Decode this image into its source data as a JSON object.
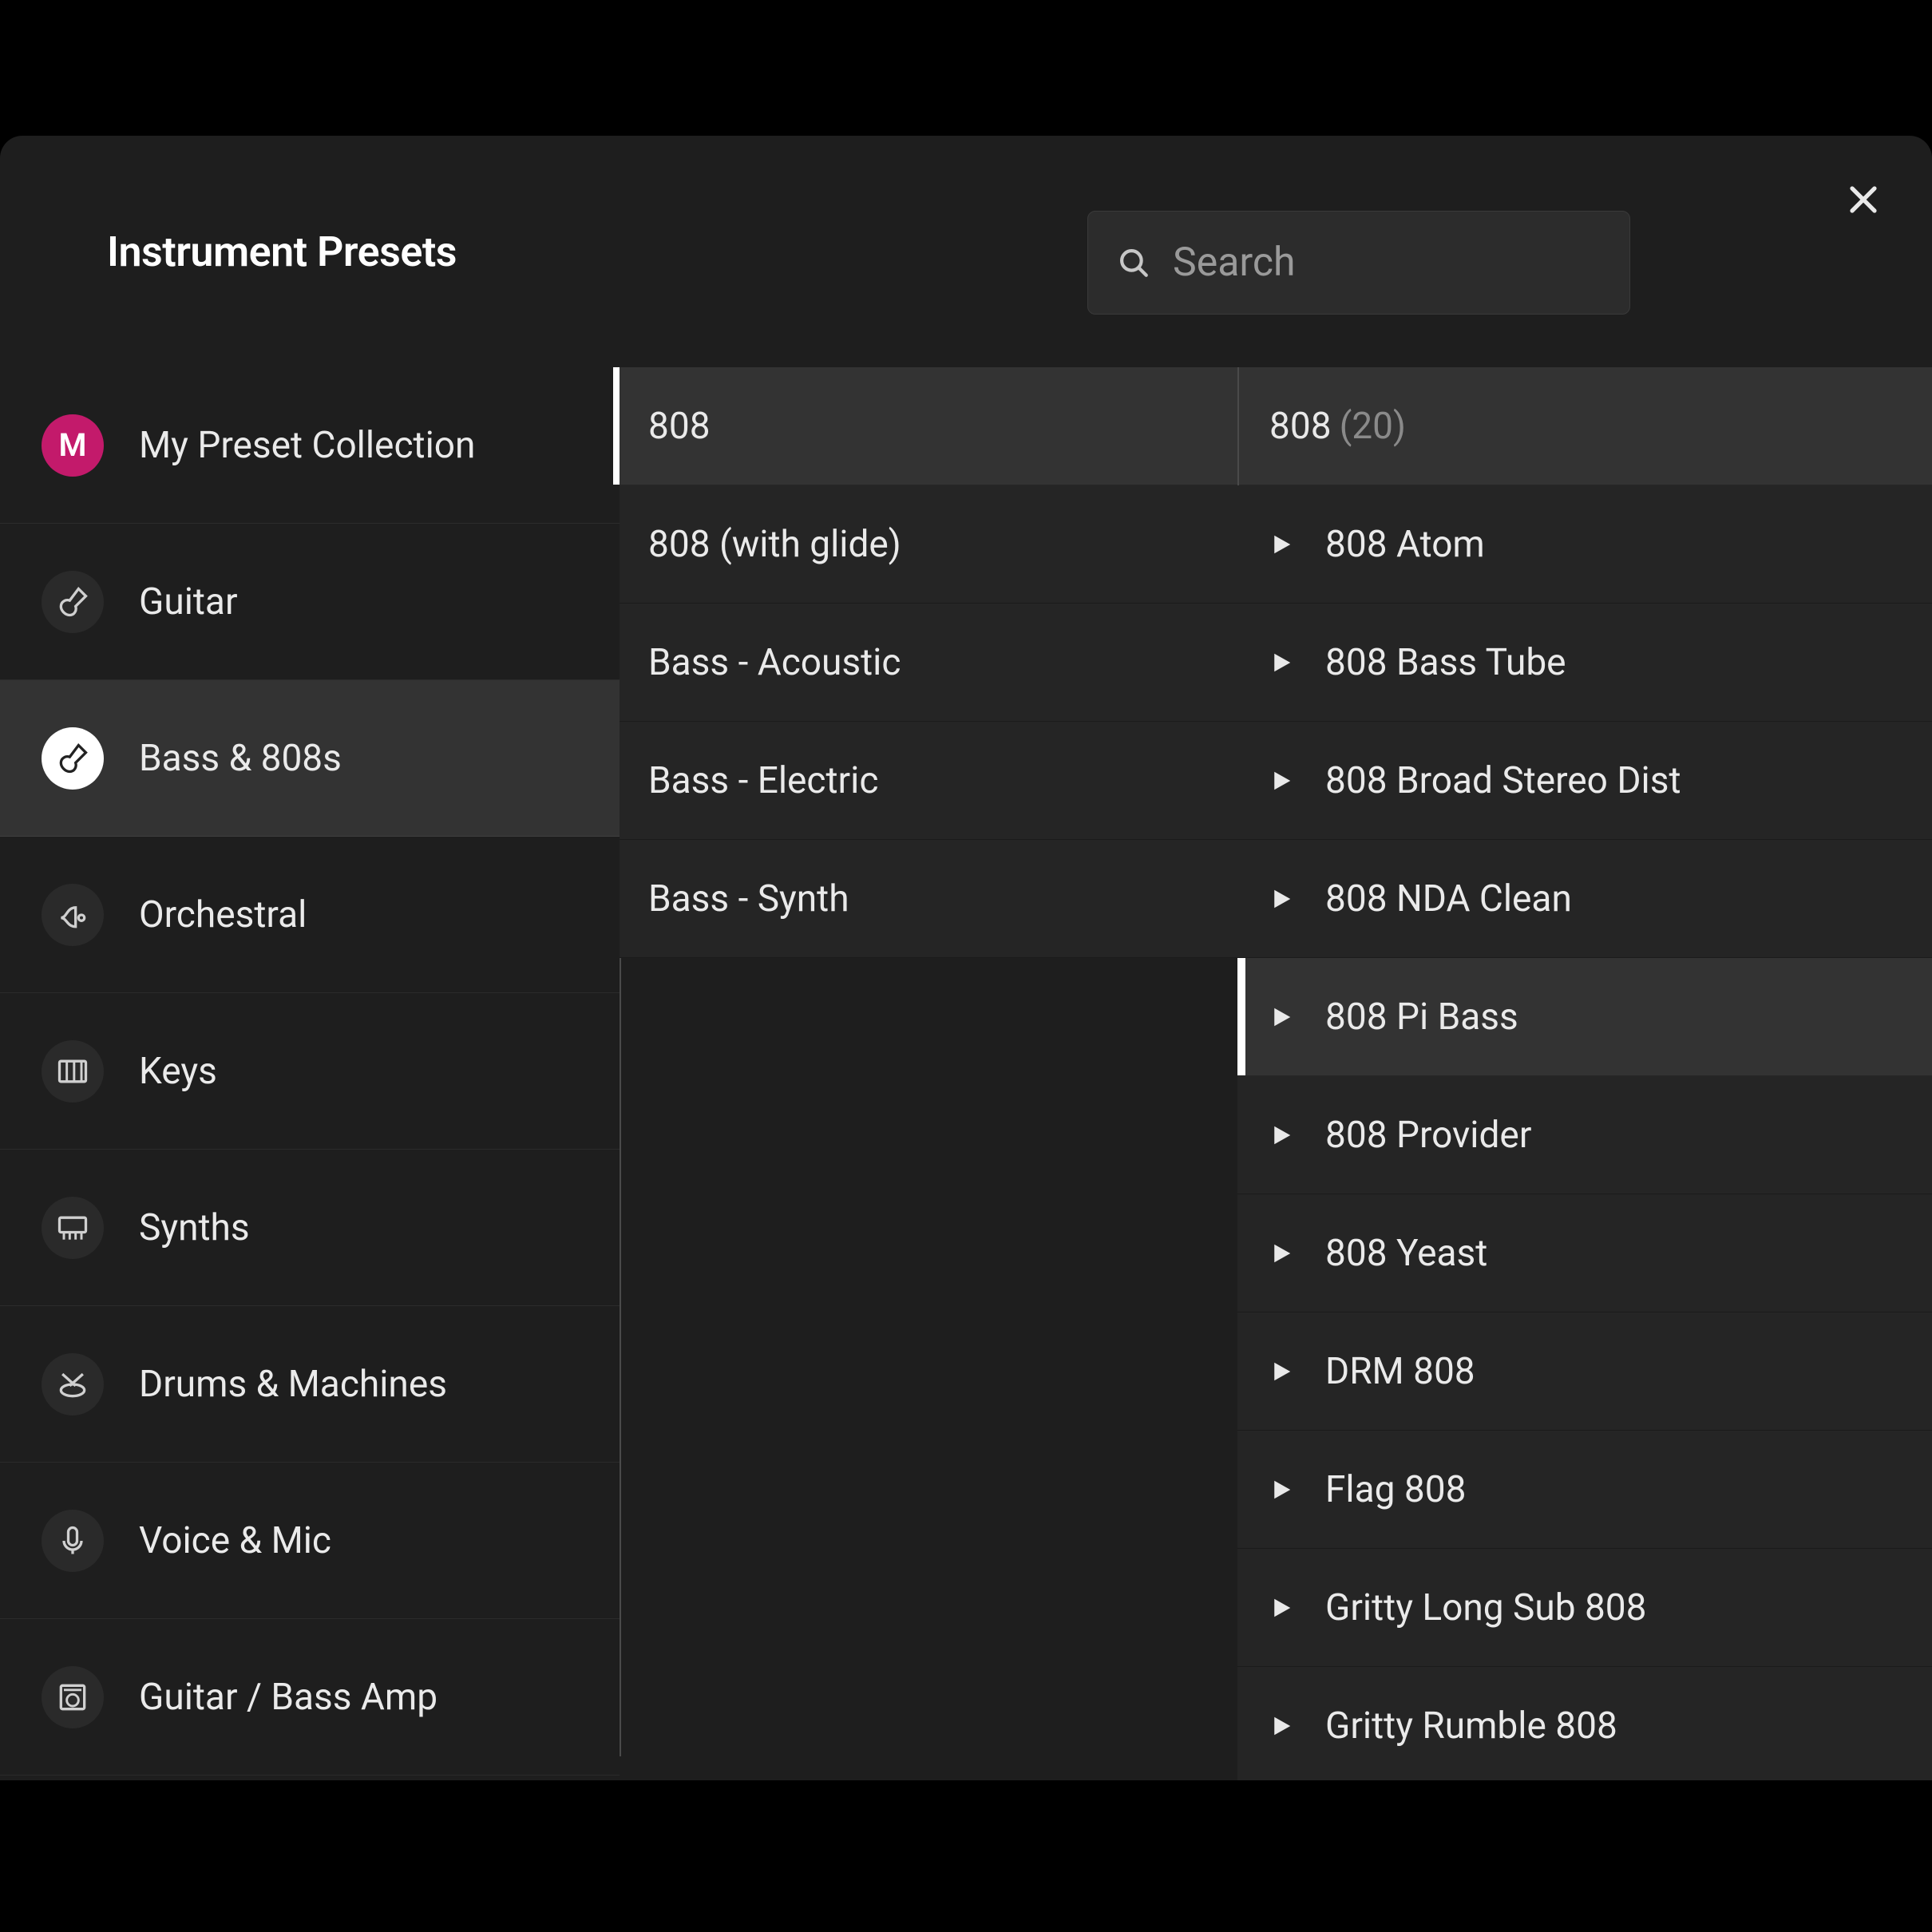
{
  "header": {
    "title": "Instrument Presets",
    "search_placeholder": "Search"
  },
  "categories": [
    {
      "id": "my-presets",
      "label": "My Preset Collection",
      "icon": "letter-m",
      "selected": false
    },
    {
      "id": "guitar",
      "label": "Guitar",
      "icon": "guitar",
      "selected": false
    },
    {
      "id": "bass",
      "label": "Bass & 808s",
      "icon": "bass",
      "selected": true
    },
    {
      "id": "orchestral",
      "label": "Orchestral",
      "icon": "horn",
      "selected": false
    },
    {
      "id": "keys",
      "label": "Keys",
      "icon": "piano",
      "selected": false
    },
    {
      "id": "synths",
      "label": "Synths",
      "icon": "synth",
      "selected": false
    },
    {
      "id": "drums",
      "label": "Drums & Machines",
      "icon": "drums",
      "selected": false
    },
    {
      "id": "voice",
      "label": "Voice & Mic",
      "icon": "mic",
      "selected": false
    },
    {
      "id": "amp",
      "label": "Guitar / Bass Amp",
      "icon": "amp",
      "selected": false
    }
  ],
  "subcategories": [
    {
      "label": "808",
      "selected": true
    },
    {
      "label": "808 (with glide)",
      "selected": false
    },
    {
      "label": "Bass - Acoustic",
      "selected": false
    },
    {
      "label": "Bass - Electric",
      "selected": false
    },
    {
      "label": "Bass - Synth",
      "selected": false
    }
  ],
  "preset_group": {
    "label": "808",
    "count": "(20)"
  },
  "presets": [
    {
      "label": "808 Atom",
      "hover": false
    },
    {
      "label": "808 Bass Tube",
      "hover": false
    },
    {
      "label": "808 Broad Stereo Dist",
      "hover": false
    },
    {
      "label": "808 NDA Clean",
      "hover": false
    },
    {
      "label": "808 Pi Bass",
      "hover": true
    },
    {
      "label": "808 Provider",
      "hover": false
    },
    {
      "label": "808 Yeast",
      "hover": false
    },
    {
      "label": "DRM 808",
      "hover": false
    },
    {
      "label": "Flag 808",
      "hover": false
    },
    {
      "label": "Gritty Long Sub 808",
      "hover": false
    },
    {
      "label": "Gritty Rumble 808",
      "hover": false
    }
  ]
}
